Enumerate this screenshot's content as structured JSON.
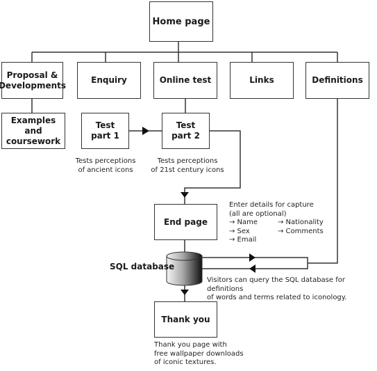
{
  "nodes": {
    "home": "Home page",
    "proposal": [
      "Proposal &",
      "Developments"
    ],
    "enquiry": "Enquiry",
    "online_test": "Online test",
    "links": "Links",
    "definitions": "Definitions",
    "examples": [
      "Examples",
      "and",
      "coursework"
    ],
    "test1": [
      "Test",
      "part 1"
    ],
    "test2": [
      "Test",
      "part 2"
    ],
    "end_page": "End page",
    "database": "SQL database",
    "thank_you": "Thank you"
  },
  "notes": {
    "test1": [
      "Tests perceptions",
      "of ancient icons"
    ],
    "test2": [
      "Tests perceptions",
      "of 21st century  icons"
    ],
    "end_page": {
      "heading": [
        "Enter details for capture",
        "(all are optional)"
      ],
      "fields": [
        "→ Name",
        "→ Nationality",
        "→ Sex",
        "→ Comments",
        "→ Email"
      ]
    },
    "database": [
      "Visitors can query the SQL database for definitions",
      "of words and terms related to iconology."
    ],
    "thank_you": [
      "Thank you page with",
      "free wallpaper downloads",
      "of iconic textures."
    ]
  }
}
